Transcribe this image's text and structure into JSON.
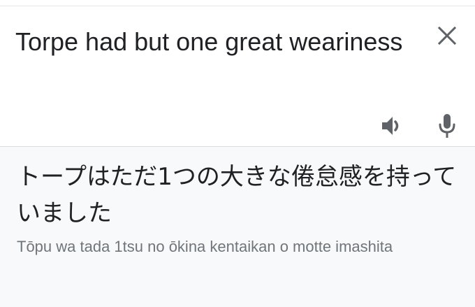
{
  "source": {
    "text": "Torpe had but one great weariness"
  },
  "translation": {
    "text": "トープはただ1つの大きな倦怠感を持っていました",
    "romanization": "Tōpu wa tada 1tsu no ōkina kentaikan o motte imashita"
  },
  "icons": {
    "close": "close-icon",
    "speaker": "speaker-icon",
    "microphone": "microphone-icon"
  },
  "colors": {
    "text_primary": "#202124",
    "text_secondary": "#70757a",
    "icon": "#5f6368",
    "result_background": "#f8f9fa"
  }
}
